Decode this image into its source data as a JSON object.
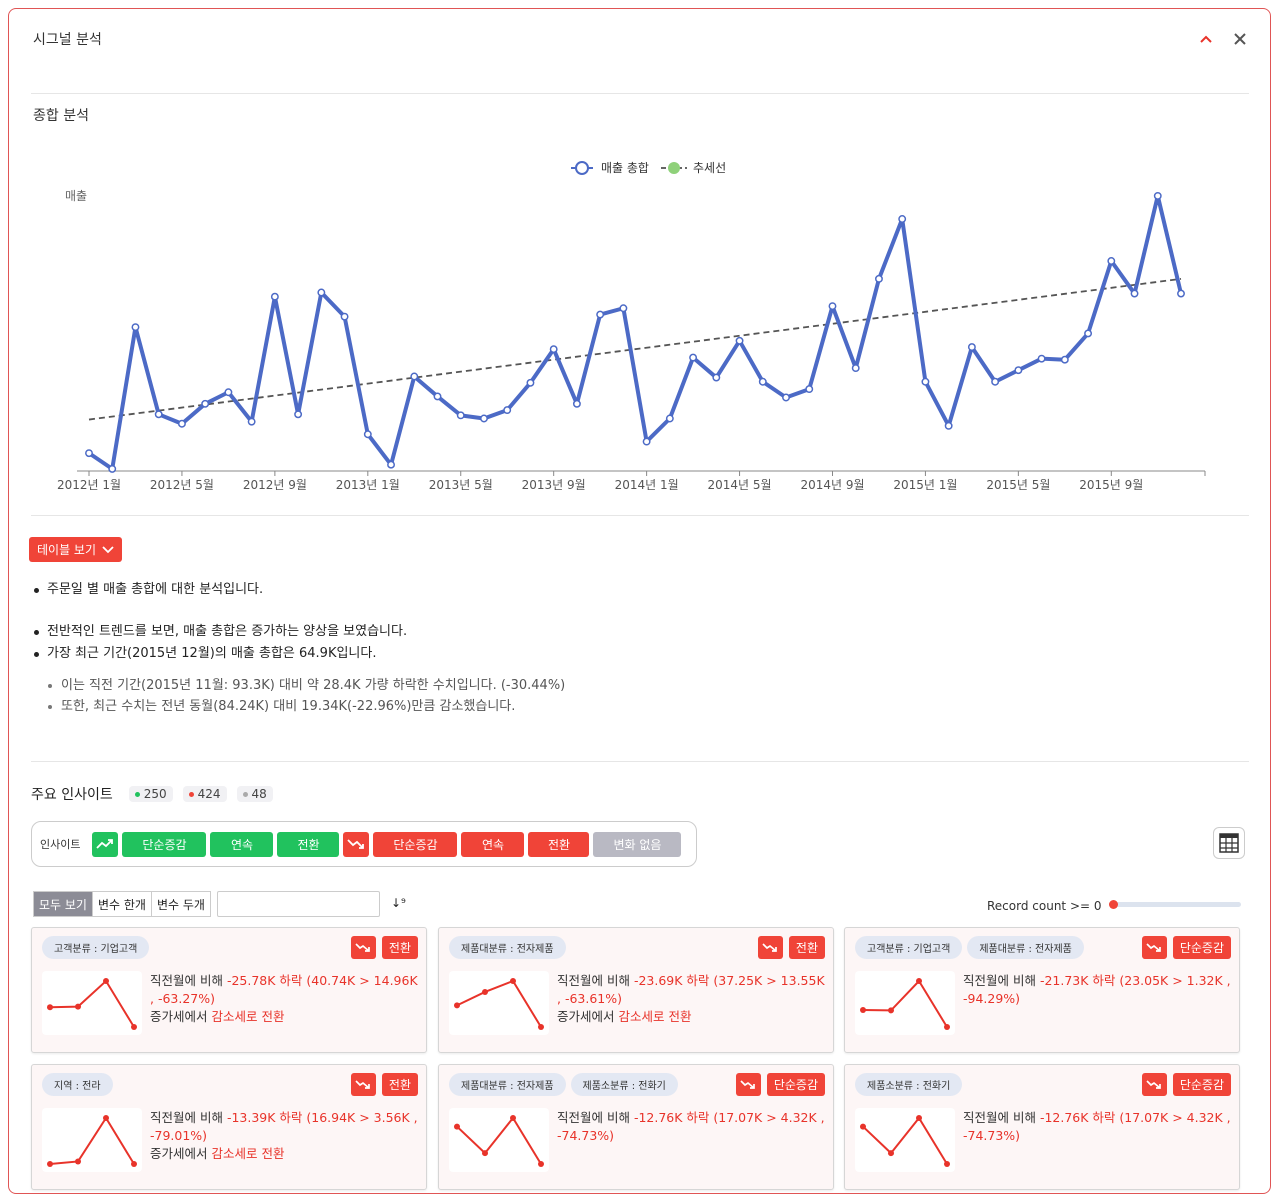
{
  "panel": {
    "title": "시그널 분석"
  },
  "section": {
    "title": "종합 분석"
  },
  "chart_data": {
    "type": "line",
    "ylabel": "매출",
    "legend": [
      "매출 총합",
      "추세선"
    ],
    "x_ticks": [
      "2012년 1월",
      "2012년 5월",
      "2012년 9월",
      "2013년 1월",
      "2013년 5월",
      "2013년 9월",
      "2014년 1월",
      "2014년 5월",
      "2014년 9월",
      "2015년 1월",
      "2015년 5월",
      "2015년 9월"
    ],
    "x": [
      "2012-01",
      "2012-02",
      "2012-03",
      "2012-04",
      "2012-05",
      "2012-06",
      "2012-07",
      "2012-08",
      "2012-09",
      "2012-10",
      "2012-11",
      "2012-12",
      "2013-01",
      "2013-02",
      "2013-03",
      "2013-04",
      "2013-05",
      "2013-06",
      "2013-07",
      "2013-08",
      "2013-09",
      "2013-10",
      "2013-11",
      "2013-12",
      "2014-01",
      "2014-02",
      "2014-03",
      "2014-04",
      "2014-05",
      "2014-06",
      "2014-07",
      "2014-08",
      "2014-09",
      "2014-10",
      "2014-11",
      "2014-12",
      "2015-01",
      "2015-02",
      "2015-03",
      "2015-04",
      "2015-05",
      "2015-06",
      "2015-07",
      "2015-08",
      "2015-09",
      "2015-10",
      "2015-11",
      "2015-12"
    ],
    "series": [
      {
        "name": "매출 총합",
        "color": "#4c6ac6",
        "values": [
          17,
          2,
          137,
          54,
          45,
          64,
          75,
          47,
          166,
          54,
          170,
          147,
          35,
          6,
          90,
          71,
          53,
          50,
          58,
          84,
          116,
          64,
          149,
          155,
          28,
          50,
          108,
          89,
          124,
          85,
          70,
          78,
          157,
          98,
          183,
          240,
          85,
          43,
          118,
          85,
          96,
          107,
          106,
          131,
          200,
          169,
          262,
          169
        ]
      },
      {
        "name": "추세선",
        "color": "#555555",
        "values": [
          49,
          183
        ]
      }
    ],
    "ylim": [
      0,
      280
    ]
  },
  "table_button": {
    "label": "테이블 보기"
  },
  "summary": {
    "b1": "주문일 별 매출 총합에 대한 분석입니다.",
    "b2": "전반적인 트렌드를 보면, 매출 총합은 증가하는 양상을 보였습니다.",
    "b3": "가장 최근 기간(2015년 12월)의 매출 총합은 64.9K입니다.",
    "s1": "이는 직전 기간(2015년 11월: 93.3K) 대비 약 28.4K 가량 하락한 수치입니다. (-30.44%)",
    "s2": "또한, 최근 수치는 전년 동월(84.24K) 대비 19.34K(-22.96%)만큼 감소했습니다."
  },
  "insights": {
    "title": "주요 인사이트",
    "count_green": "250",
    "count_red": "424",
    "count_gray": "48",
    "filter_label": "인사이트",
    "up_chips": [
      "단순증감",
      "연속",
      "전환"
    ],
    "down_chips": [
      "단순증감",
      "연속",
      "전환"
    ],
    "none_chip": "변화 없음",
    "seg": [
      "모두 보기",
      "변수 한개",
      "변수 두개"
    ],
    "search_placeholder": "",
    "sort_label": "↓⁹",
    "record_label": "Record count >=  0"
  },
  "cards": [
    {
      "tags": [
        "고객분류 : 기업고객"
      ],
      "badge": "전환",
      "pre": "직전월에 비해 ",
      "delta": "-25.78K 하락 (40.74K  >  14.96K ,  -63.27%)",
      "post_pre": "증가세에서 ",
      "post_red": "감소세로 전환",
      "spark": [
        40.74,
        41.5,
        75,
        14.96
      ]
    },
    {
      "tags": [
        "제품대분류 : 전자제품"
      ],
      "badge": "전환",
      "pre": "직전월에 비해 ",
      "delta": "-23.69K 하락 (37.25K  >  13.55K ,  -63.61%)",
      "post_pre": "증가세에서 ",
      "post_red": "감소세로 전환",
      "spark": [
        37.25,
        52,
        64,
        13.55
      ]
    },
    {
      "tags": [
        "고객분류 : 기업고객",
        "제품대분류 : 전자제품"
      ],
      "badge": "단순증감",
      "pre": "직전월에 비해 ",
      "delta": "-21.73K 하락 (23.05K  >  1.32K ,  -94.29%)",
      "post_pre": "",
      "post_red": "",
      "spark": [
        23.05,
        22.5,
        60,
        1.32
      ]
    },
    {
      "tags": [
        "지역 : 전라"
      ],
      "badge": "전환",
      "pre": "직전월에 비해 ",
      "delta": "-13.39K 하락 (16.94K  >  3.56K ,  -79.01%)",
      "post_pre": "증가세에서 ",
      "post_red": "감소세로 전환",
      "spark": [
        3.56,
        6,
        48,
        3.56
      ]
    },
    {
      "tags": [
        "제품대분류 : 전자제품",
        "제품소분류 : 전화기"
      ],
      "badge": "단순증감",
      "pre": "직전월에 비해 ",
      "delta": "-12.76K 하락 (17.07K  >  4.32K ,  -74.73%)",
      "post_pre": "",
      "post_red": "",
      "spark": [
        48,
        17,
        58,
        4.32
      ]
    },
    {
      "tags": [
        "제품소분류 : 전화기"
      ],
      "badge": "단순증감",
      "pre": "직전월에 비해 ",
      "delta": "-12.76K 하락 (17.07K  >  4.32K ,  -74.73%)",
      "post_pre": "",
      "post_red": "",
      "spark": [
        48,
        17,
        58,
        4.32
      ]
    }
  ]
}
